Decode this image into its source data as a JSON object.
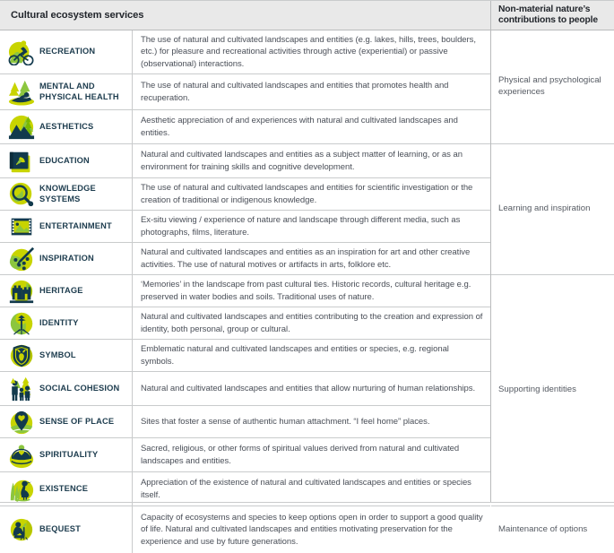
{
  "header": {
    "left_title": "Cultural ecosystem services",
    "right_title_line1": "Non-material nature’s",
    "right_title_line2": "contributions to people"
  },
  "rows": [
    {
      "icon": "cycling-recreation-icon",
      "name": "RECREATION",
      "desc": "The use of natural and cultivated landscapes and entities (e.g. lakes, hills, trees, boulders, etc.) for pleasure and recreational activities through active (experiential) or passive (observational) interactions.",
      "height": 49
    },
    {
      "icon": "person-relaxing-trees-icon",
      "name": "MENTAL AND PHYSICAL HEALTH",
      "desc": "The use of natural and cultivated landscapes and entities that promotes health and recuperation.",
      "height": 40
    },
    {
      "icon": "mountain-landscape-icon",
      "name": "AESTHETICS",
      "desc": "Aesthetic appreciation of and experiences with natural and cultivated landscapes and entities.",
      "height": 38
    },
    {
      "icon": "book-leaf-icon",
      "name": "EDUCATION",
      "desc": "Natural and cultivated landscapes and entities as a subject matter of learning, or as an environment for training skills and cognitive development.",
      "height": 38
    },
    {
      "icon": "magnifier-knowledge-icon",
      "name": "KNOWLEDGE SYSTEMS",
      "desc": "The use of natural and cultivated landscapes and entities for scientific investigation or the creation of traditional or indigenous knowledge.",
      "height": 36
    },
    {
      "icon": "film-photo-icon",
      "name": "ENTERTAINMENT",
      "desc": "Ex-situ viewing / experience of nature and landscape through different media, such as photographs, films, literature.",
      "height": 36
    },
    {
      "icon": "paint-palette-icon",
      "name": "INSPIRATION",
      "desc": "Natural and cultivated landscapes and entities as an inspiration for art and other creative activities. The use of natural motives or artifacts in arts, folklore etc.",
      "height": 36
    },
    {
      "icon": "castle-ruins-icon",
      "name": "HERITAGE",
      "desc": "‘Memories’ in the landscape from past cultural ties. Historic records, cultural heritage e.g. preserved in water bodies and soils. Traditional uses of nature.",
      "height": 36
    },
    {
      "icon": "tree-roots-icon",
      "name": "IDENTITY",
      "desc": "Natural and cultivated landscapes and entities contributing to the creation and expression of identity, both personal, group or cultural.",
      "height": 36
    },
    {
      "icon": "deer-crest-shield-icon",
      "name": "SYMBOL",
      "desc": "Emblematic natural and cultivated landscapes and entities or species, e.g. regional symbols.",
      "height": 36
    },
    {
      "icon": "family-group-icon",
      "name": "SOCIAL COHESION",
      "desc": "Natural and cultivated landscapes and entities that allow nurturing of human relationships.",
      "height": 38
    },
    {
      "icon": "map-pin-heart-icon",
      "name": "SENSE OF PLACE",
      "desc": "Sites that foster a sense of authentic human attachment. “I feel home” places.",
      "height": 36
    },
    {
      "icon": "meditation-figure-icon",
      "name": "SPIRITUALITY",
      "desc": "Sacred, religious, or other forms of spiritual values derived from natural and cultivated landscapes and entities.",
      "height": 38
    },
    {
      "icon": "heron-reeds-icon",
      "name": "EXISTENCE",
      "desc": "Appreciation of the existence of natural and cultivated landscapes and entities or species itself.",
      "height": 38
    },
    {
      "icon": "planting-seedling-icon",
      "name": "BEQUEST",
      "desc": "Capacity of ecosystems and species to keep options open in order to support a good quality of life. Natural and cultivated landscapes and entities motivating preservation for the experience and use by future generations.",
      "height": 52
    }
  ],
  "groups": [
    {
      "label": "Physical and psychological experiences",
      "span_rows": 3
    },
    {
      "label": "Learning and inspiration",
      "span_rows": 4
    },
    {
      "label": "Supporting identities",
      "span_rows": 7
    },
    {
      "label": "Maintenance of options",
      "span_rows": 1
    }
  ],
  "colors": {
    "accent_green": "#c8d400",
    "dark_navy": "#123a4d",
    "mid_green": "#7ab800",
    "header_bg": "#e9e9e9",
    "border": "#c9cbcc",
    "title_text": "#1d3c4e"
  }
}
